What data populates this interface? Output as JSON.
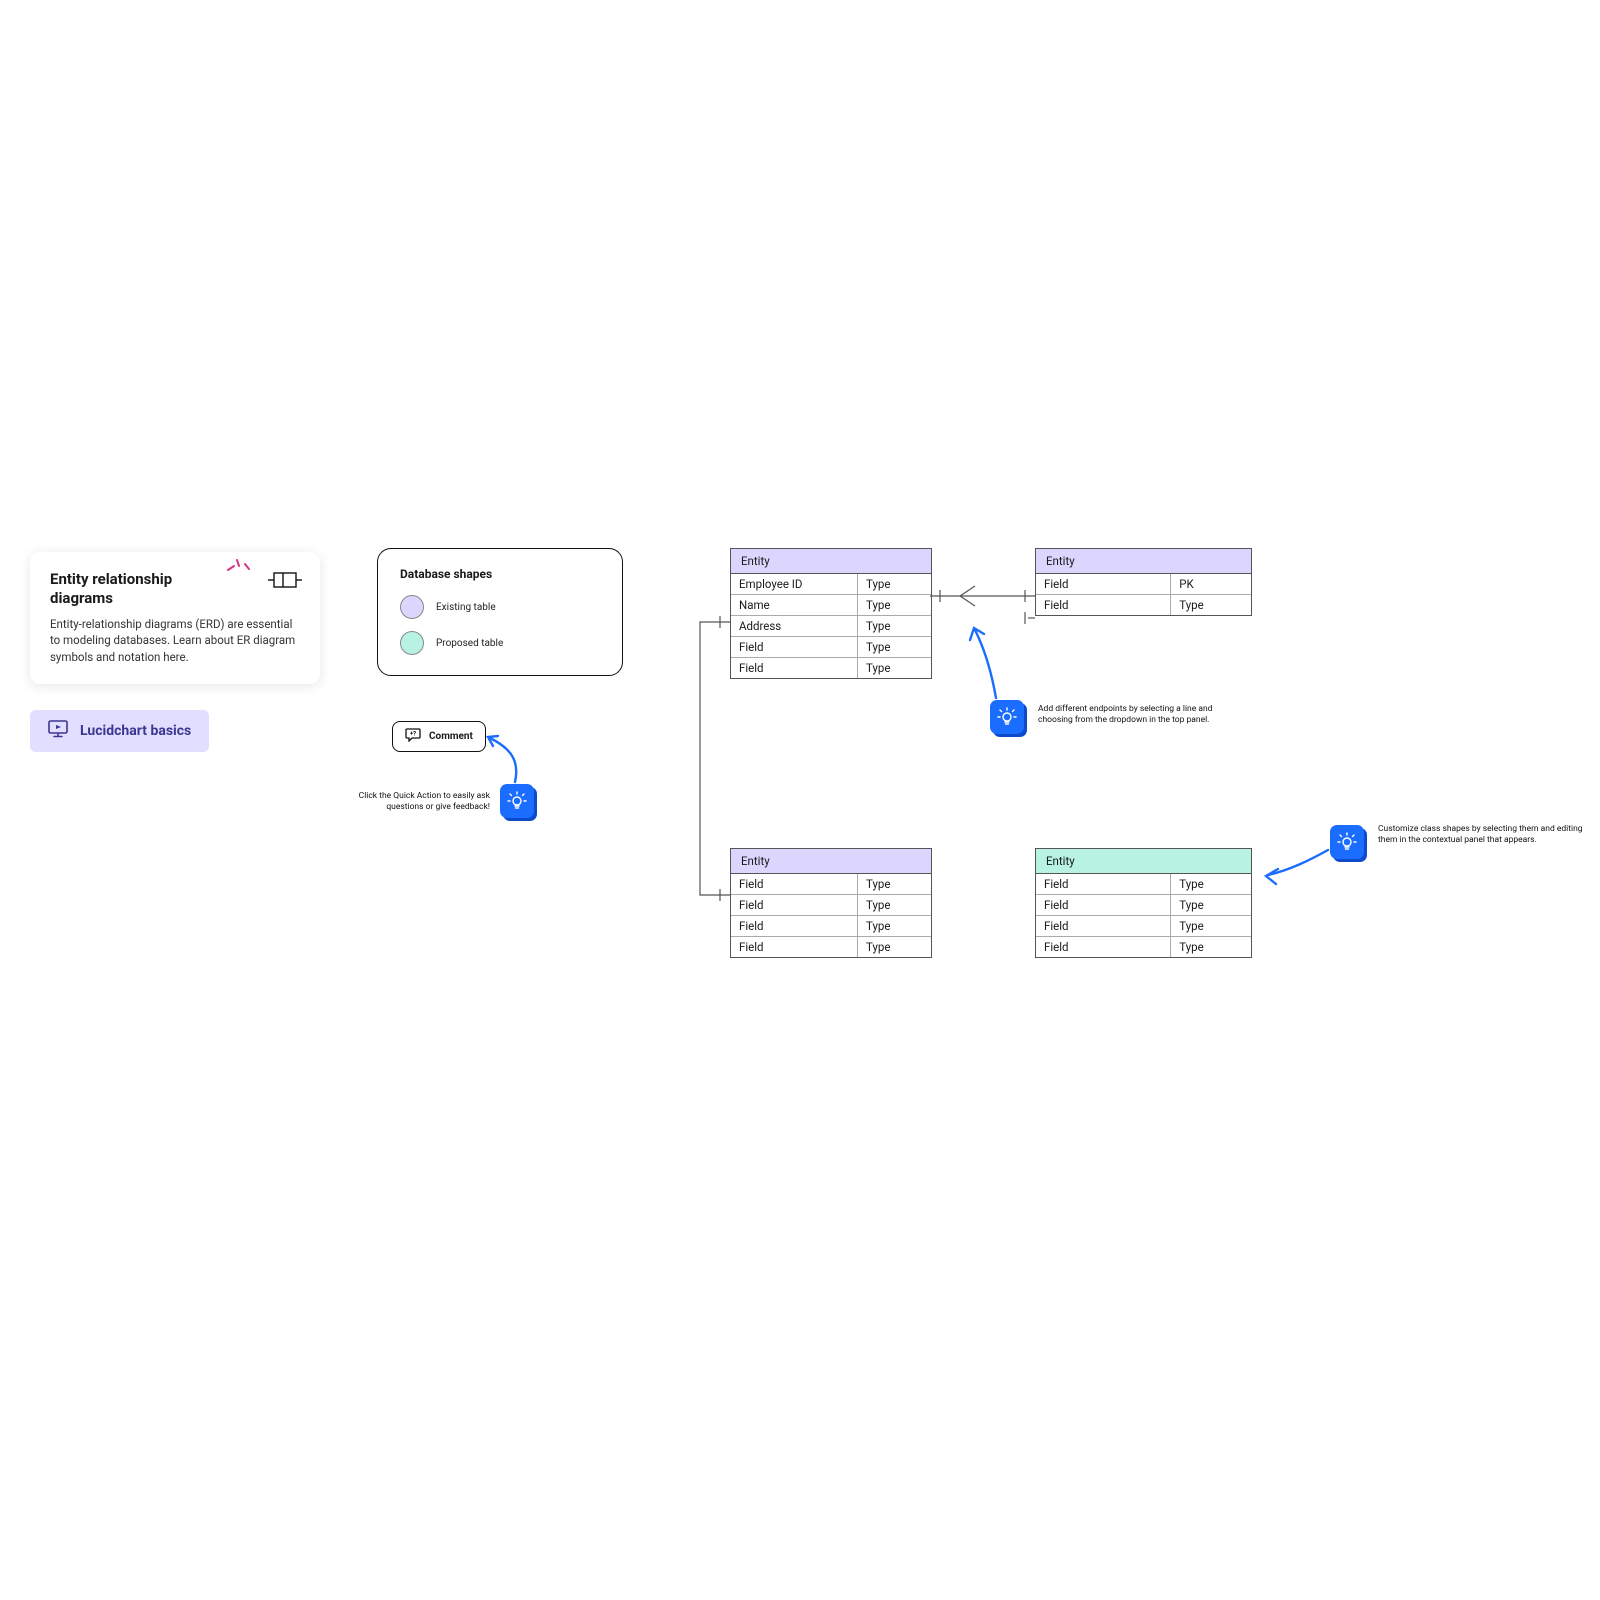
{
  "intro": {
    "title": "Entity relationship diagrams",
    "body": "Entity-relationship diagrams (ERD) are essential to modeling databases. Learn about ER diagram symbols and notation here."
  },
  "basics": {
    "label": "Lucidchart basics"
  },
  "legend": {
    "title": "Database shapes",
    "items": [
      {
        "label": "Existing table"
      },
      {
        "label": "Proposed table"
      }
    ]
  },
  "comment": {
    "label": "Comment"
  },
  "tips": {
    "comment_tip": "Click the Quick Action to easily ask questions or give feedback!",
    "endpoints_tip": "Add different endpoints by selecting a line and choosing from the dropdown in the top panel.",
    "customize_tip": "Customize class shapes by selecting them and editing them in the contextual panel that appears."
  },
  "tables": {
    "t1": {
      "name": "Entity",
      "rows": [
        {
          "f": "Employee ID",
          "t": "Type"
        },
        {
          "f": "Name",
          "t": "Type"
        },
        {
          "f": "Address",
          "t": "Type"
        },
        {
          "f": "Field",
          "t": "Type"
        },
        {
          "f": "Field",
          "t": "Type"
        }
      ]
    },
    "t2": {
      "name": "Entity",
      "rows": [
        {
          "f": "Field",
          "t": "PK"
        },
        {
          "f": "Field",
          "t": "Type"
        }
      ]
    },
    "t3": {
      "name": "Entity",
      "rows": [
        {
          "f": "Field",
          "t": "Type"
        },
        {
          "f": "Field",
          "t": "Type"
        },
        {
          "f": "Field",
          "t": "Type"
        },
        {
          "f": "Field",
          "t": "Type"
        }
      ]
    },
    "t4": {
      "name": "Entity",
      "rows": [
        {
          "f": "Field",
          "t": "Type"
        },
        {
          "f": "Field",
          "t": "Type"
        },
        {
          "f": "Field",
          "t": "Type"
        },
        {
          "f": "Field",
          "t": "Type"
        }
      ]
    }
  }
}
